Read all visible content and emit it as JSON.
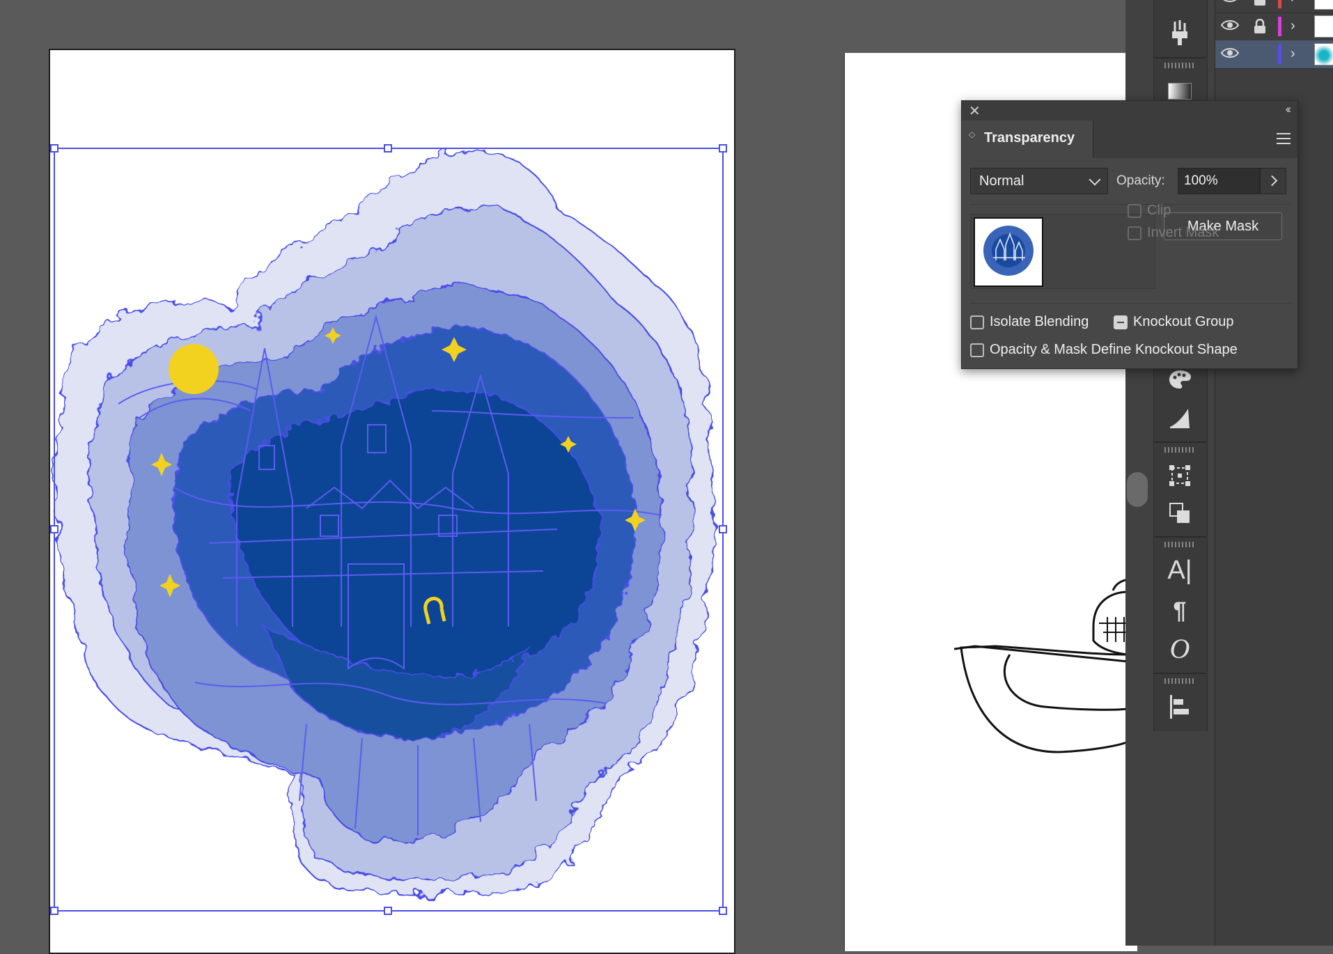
{
  "transparency_panel": {
    "tab_label": "Transparency",
    "blend_mode": "Normal",
    "opacity_label": "Opacity:",
    "opacity_value": "100%",
    "make_mask_label": "Make Mask",
    "clip_label": "Clip",
    "invert_mask_label": "Invert Mask",
    "isolate_blending_label": "Isolate Blending",
    "knockout_group_label": "Knockout Group",
    "opacity_mask_knockout_label": "Opacity & Mask Define Knockout Shape"
  },
  "tools": {
    "character_glyph": "A|",
    "paragraph_glyph": "¶",
    "opentype_glyph": "O"
  },
  "layers": [
    {
      "color": "#e04848",
      "locked": true
    },
    {
      "color": "#d83ee0",
      "locked": true
    },
    {
      "color": "#5a4de6",
      "locked": false,
      "selected": true
    }
  ],
  "colors": {
    "selection": "#4a4ee8",
    "ink": "#0b3a8c",
    "accent_yellow": "#f2d21e"
  },
  "icons": [
    "close-icon",
    "collapse-icon",
    "panel-menu-icon",
    "chevron-down-icon",
    "chevron-right-icon",
    "eye-icon",
    "lock-icon",
    "brush-icon",
    "gradient-icon",
    "palette-icon",
    "shape-icon",
    "transform-icon",
    "pathfinder-icon",
    "character-icon",
    "paragraph-icon",
    "opentype-icon",
    "align-icon"
  ]
}
